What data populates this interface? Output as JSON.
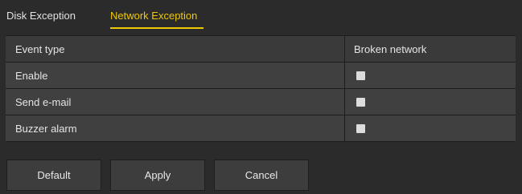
{
  "tabs": {
    "disk_exception": "Disk Exception",
    "network_exception": "Network Exception",
    "active": "network_exception",
    "active_color": "#f0c800"
  },
  "table": {
    "header": {
      "label": "Event type",
      "value": "Broken network"
    },
    "rows": [
      {
        "label": "Enable",
        "checked": false
      },
      {
        "label": "Send e-mail",
        "checked": false
      },
      {
        "label": "Buzzer alarm",
        "checked": false
      }
    ]
  },
  "buttons": {
    "default": "Default",
    "apply": "Apply",
    "cancel": "Cancel"
  }
}
